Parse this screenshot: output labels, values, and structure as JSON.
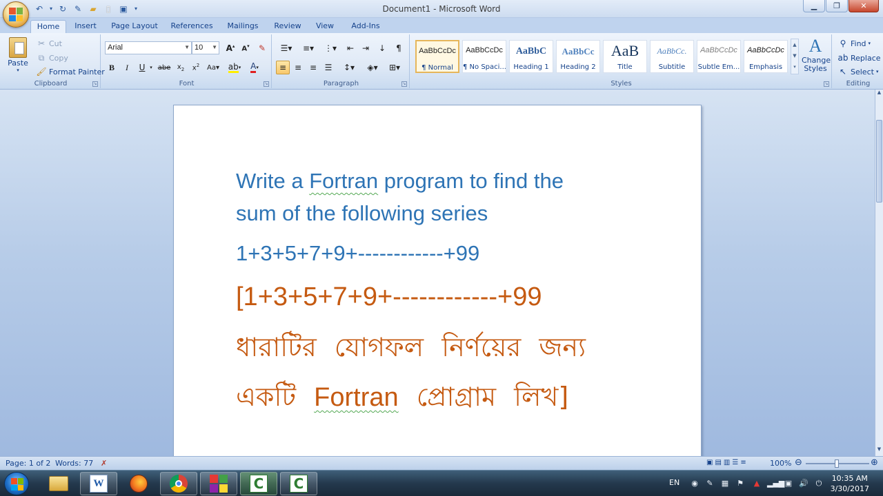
{
  "window": {
    "title": "Document1 - Microsoft Word"
  },
  "tabs": [
    "Home",
    "Insert",
    "Page Layout",
    "References",
    "Mailings",
    "Review",
    "View",
    "Add-Ins"
  ],
  "clipboard": {
    "paste": "Paste",
    "cut": "Cut",
    "copy": "Copy",
    "format_painter": "Format Painter",
    "label": "Clipboard"
  },
  "font": {
    "name": "Arial",
    "size": "10",
    "label": "Font"
  },
  "paragraph": {
    "label": "Paragraph"
  },
  "styles": {
    "label": "Styles",
    "items": [
      {
        "preview": "AaBbCcDc",
        "name": "¶ Normal"
      },
      {
        "preview": "AaBbCcDc",
        "name": "¶ No Spaci..."
      },
      {
        "preview": "AaBbC",
        "name": "Heading 1"
      },
      {
        "preview": "AaBbCc",
        "name": "Heading 2"
      },
      {
        "preview": "AaB",
        "name": "Title"
      },
      {
        "preview": "AaBbCc.",
        "name": "Subtitle"
      },
      {
        "preview": "AaBbCcDc",
        "name": "Subtle Em..."
      },
      {
        "preview": "AaBbCcDc",
        "name": "Emphasis"
      }
    ],
    "change_styles": "Change Styles"
  },
  "editing": {
    "find": "Find",
    "replace": "Replace",
    "select": "Select",
    "label": "Editing"
  },
  "document": {
    "line1a": "Write a ",
    "line1b": "Fortran",
    "line1c": " program to find the",
    "line2": "sum of the following series",
    "line3": "1+3+5+7+9+------------+99",
    "line4": "[1+3+5+7+9+------------+99",
    "line5": "ধারাটির যোগফল নির্ণয়ের জন্য",
    "line6a": "একটি ",
    "line6b": "Fortran",
    "line6c": " প্রোগ্রাম লিখ]"
  },
  "statusbar": {
    "page": "Page: 1 of 2",
    "words": "Words: 77",
    "zoom": "100%"
  },
  "taskbar": {
    "lang": "EN",
    "time": "10:35 AM",
    "date": "3/30/2017"
  },
  "colors": {
    "blue_text": "#2e74b5",
    "orange_text": "#c55a11"
  }
}
